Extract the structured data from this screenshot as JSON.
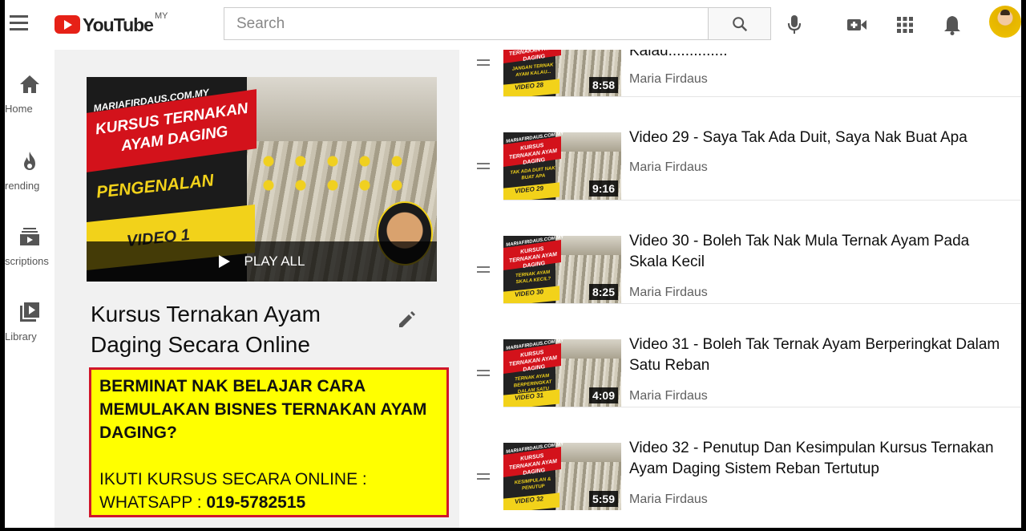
{
  "header": {
    "logo_text": "YouTube",
    "logo_region": "MY",
    "search_placeholder": "Search",
    "icons": [
      "menu-icon",
      "search-icon",
      "microphone-icon",
      "create-video-icon",
      "apps-grid-icon",
      "bell-icon",
      "avatar"
    ]
  },
  "guide": {
    "items": [
      {
        "label": "Home",
        "icon": "home-icon"
      },
      {
        "label": "rending",
        "icon": "flame-icon"
      },
      {
        "label": "scriptions",
        "icon": "subscriptions-icon"
      },
      {
        "label": "Library",
        "icon": "library-icon"
      }
    ]
  },
  "playlist": {
    "thumb": {
      "site": "MARIAFIRDAUS.COM.MY",
      "headline": "KURSUS TERNAKAN AYAM DAGING",
      "subtitle": "PENGENALAN",
      "video_label": "VIDEO 1"
    },
    "play_all": "PLAY ALL",
    "title": "Kursus Ternakan Ayam Daging Secara Online",
    "description": {
      "question": "BERMINAT NAK BELAJAR CARA MEMULAKAN BISNES TERNAKAN AYAM DAGING?",
      "line1": "IKUTI KURSUS SECARA ONLINE :",
      "line2_prefix": "WHATSAPP : ",
      "phone": "019-5782515"
    }
  },
  "videos": [
    {
      "title": "Kalau..............",
      "channel": "Maria Firdaus",
      "duration": "8:58",
      "thumb_sub": "JANGAN TERNAK AYAM KALAU...",
      "thumb_label": "VIDEO 28"
    },
    {
      "title": "Video 29 - Saya Tak Ada Duit, Saya Nak Buat Apa",
      "channel": "Maria Firdaus",
      "duration": "9:16",
      "thumb_sub": "TAK ADA DUIT NAK BUAT APA",
      "thumb_label": "VIDEO 29"
    },
    {
      "title": "Video 30 - Boleh Tak Nak Mula Ternak Ayam Pada Skala Kecil",
      "channel": "Maria Firdaus",
      "duration": "8:25",
      "thumb_sub": "TERNAK AYAM SKALA KECIL?",
      "thumb_label": "VIDEO 30"
    },
    {
      "title": "Video 31 - Boleh Tak Ternak Ayam Berperingkat Dalam Satu Reban",
      "channel": "Maria Firdaus",
      "duration": "4:09",
      "thumb_sub": "TERNAK AYAM BERPERINGKAT DALAM SATU REBAN",
      "thumb_label": "VIDEO 31"
    },
    {
      "title": "Video 32 - Penutup Dan Kesimpulan Kursus Ternakan Ayam Daging Sistem Reban Tertutup",
      "channel": "Maria Firdaus",
      "duration": "5:59",
      "thumb_sub": "KESIMPULAN & PENUTUP",
      "thumb_label": "VIDEO 32"
    }
  ],
  "thumb_common": {
    "site": "MARIAFIRDAUS.COM.MY",
    "headline": "KURSUS TERNAKAN AYAM DAGING"
  },
  "colors": {
    "brand_red": "#e62117",
    "highlight_yellow": "#ffff00",
    "box_border": "#d0162b"
  }
}
